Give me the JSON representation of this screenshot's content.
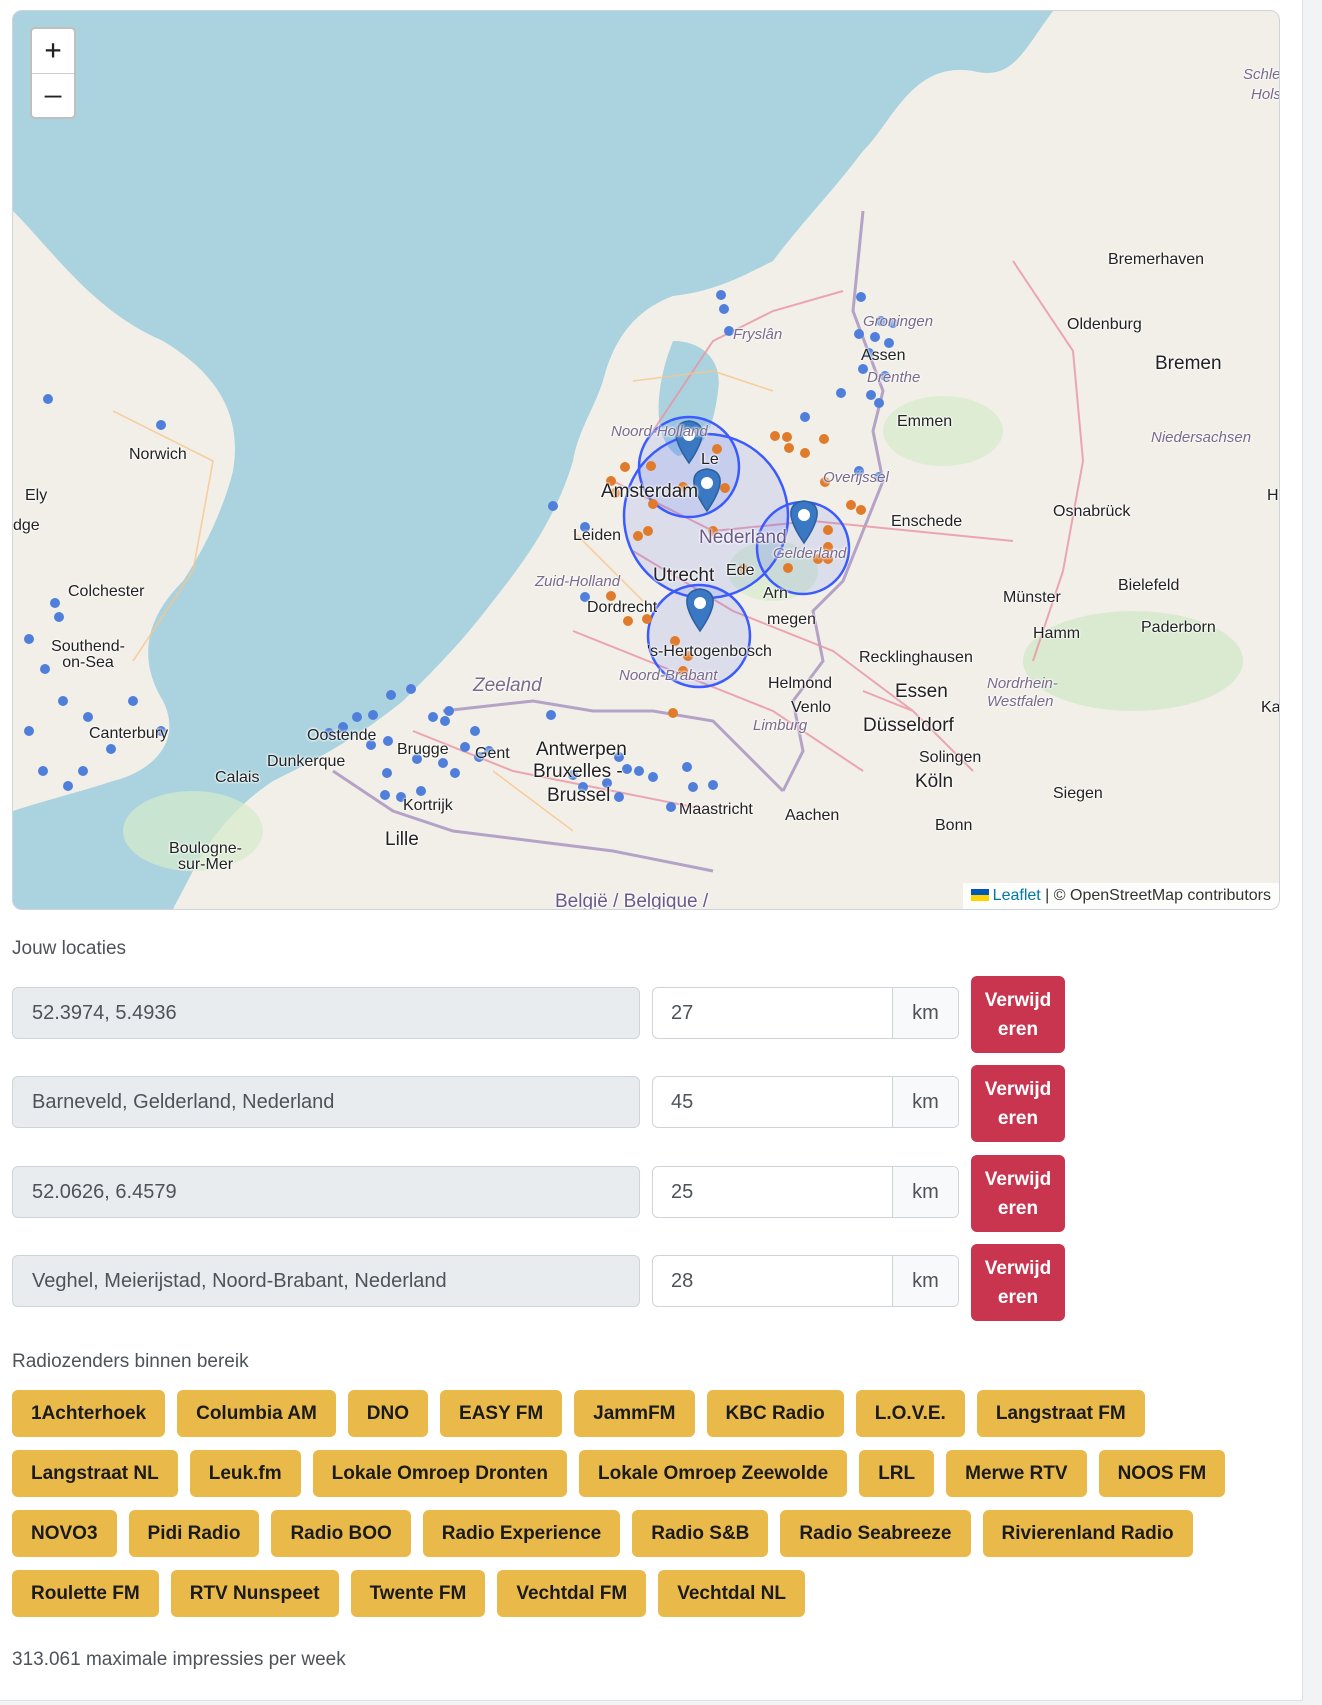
{
  "map": {
    "zoom_in": "+",
    "zoom_out": "–",
    "attribution_link": "Leaflet",
    "attribution_text": "| © OpenStreetMap contributors",
    "labels": {
      "schleswig": "Schle",
      "holstein": "Hols",
      "bremerhaven": "Bremerhaven",
      "groningen": "Groningen",
      "oldenburg": "Oldenburg",
      "bremen": "Bremen",
      "fryslan": "Fryslân",
      "assen": "Assen",
      "drenthe": "Drenthe",
      "emmen": "Emmen",
      "niedersachsen": "Niedersachsen",
      "norwich": "Norwich",
      "noord_holland": "Noord-Holland",
      "lelystad": "Le",
      "overijssel": "Overijssel",
      "amsterdam": "Amsterdam",
      "osnabruck": "Osnabrück",
      "ely": "Ely",
      "edge": "dge",
      "leiden": "Leiden",
      "nederland": "Nederland",
      "enschede": "Enschede",
      "gelderland": "Gelderland",
      "colchester": "Colchester",
      "zuid_holland": "Zuid-Holland",
      "utrecht": "Utrecht",
      "ede": "Ede",
      "bielefeld": "Bielefeld",
      "dordrecht": "Dordrecht",
      "arnhem": "Arn",
      "munster": "Münster",
      "southend": "Southend-on-Sea",
      "nijmegen": "megen",
      "paderborn": "Paderborn",
      "hamm": "Hamm",
      "shertogenbosch": "'s-Hertogenbosch",
      "recklinghausen": "Recklinghausen",
      "noord_brabant": "Noord-Brabant",
      "zeeland": "Zeeland",
      "helmond": "Helmond",
      "essen": "Essen",
      "nrw": "Nordrhein-Westfalen",
      "venlo": "Venlo",
      "kassel": "Kas",
      "canterbury": "Canterbury",
      "oostende": "Oostende",
      "limburg": "Limburg",
      "dusseldorf": "Düsseldorf",
      "brugge": "Brugge",
      "dunkerque": "Dunkerque",
      "gent": "Gent",
      "antwerpen": "Antwerpen",
      "solingen": "Solingen",
      "calais": "Calais",
      "bruxelles": "Bruxelles -",
      "brussel": "Brussel",
      "koln": "Köln",
      "siegen": "Siegen",
      "kortrijk": "Kortrijk",
      "maastricht": "Maastricht",
      "aachen": "Aachen",
      "bonn": "Bonn",
      "lille": "Lille",
      "boulogne": "Boulogne-sur-Mer",
      "belgie": "België / Belgique /",
      "h": "H"
    }
  },
  "locations_heading": "Jouw locaties",
  "locations": [
    {
      "place": "52.3974, 5.4936",
      "radius": "27",
      "unit": "km",
      "delete_label": "Verwijderen"
    },
    {
      "place": "Barneveld, Gelderland, Nederland",
      "radius": "45",
      "unit": "km",
      "delete_label": "Verwijderen"
    },
    {
      "place": "52.0626, 6.4579",
      "radius": "25",
      "unit": "km",
      "delete_label": "Verwijderen"
    },
    {
      "place": "Veghel, Meierijstad, Noord-Brabant, Nederland",
      "radius": "28",
      "unit": "km",
      "delete_label": "Verwijderen"
    }
  ],
  "stations_heading": "Radiozenders binnen bereik",
  "stations": [
    "1Achterhoek",
    "Columbia AM",
    "DNO",
    "EASY FM",
    "JammFM",
    "KBC Radio",
    "L.O.V.E.",
    "Langstraat FM",
    "Langstraat NL",
    "Leuk.fm",
    "Lokale Omroep Dronten",
    "Lokale Omroep Zeewolde",
    "LRL",
    "Merwe RTV",
    "NOOS FM",
    "NOVO3",
    "Pidi Radio",
    "Radio BOO",
    "Radio Experience",
    "Radio S&B",
    "Radio Seabreeze",
    "Rivierenland Radio",
    "Roulette FM",
    "RTV Nunspeet",
    "Twente FM",
    "Vechtdal FM",
    "Vechtdal NL"
  ],
  "impressions_text": "313.061 maximale impressies per week",
  "colors": {
    "danger": "#c9344e",
    "station_pill": "#e9b949",
    "marker": "#3a78c3",
    "circle": "#3b5bfd",
    "in_range_dot": "#e07b2b",
    "out_range_dot": "#4f7fdb"
  }
}
